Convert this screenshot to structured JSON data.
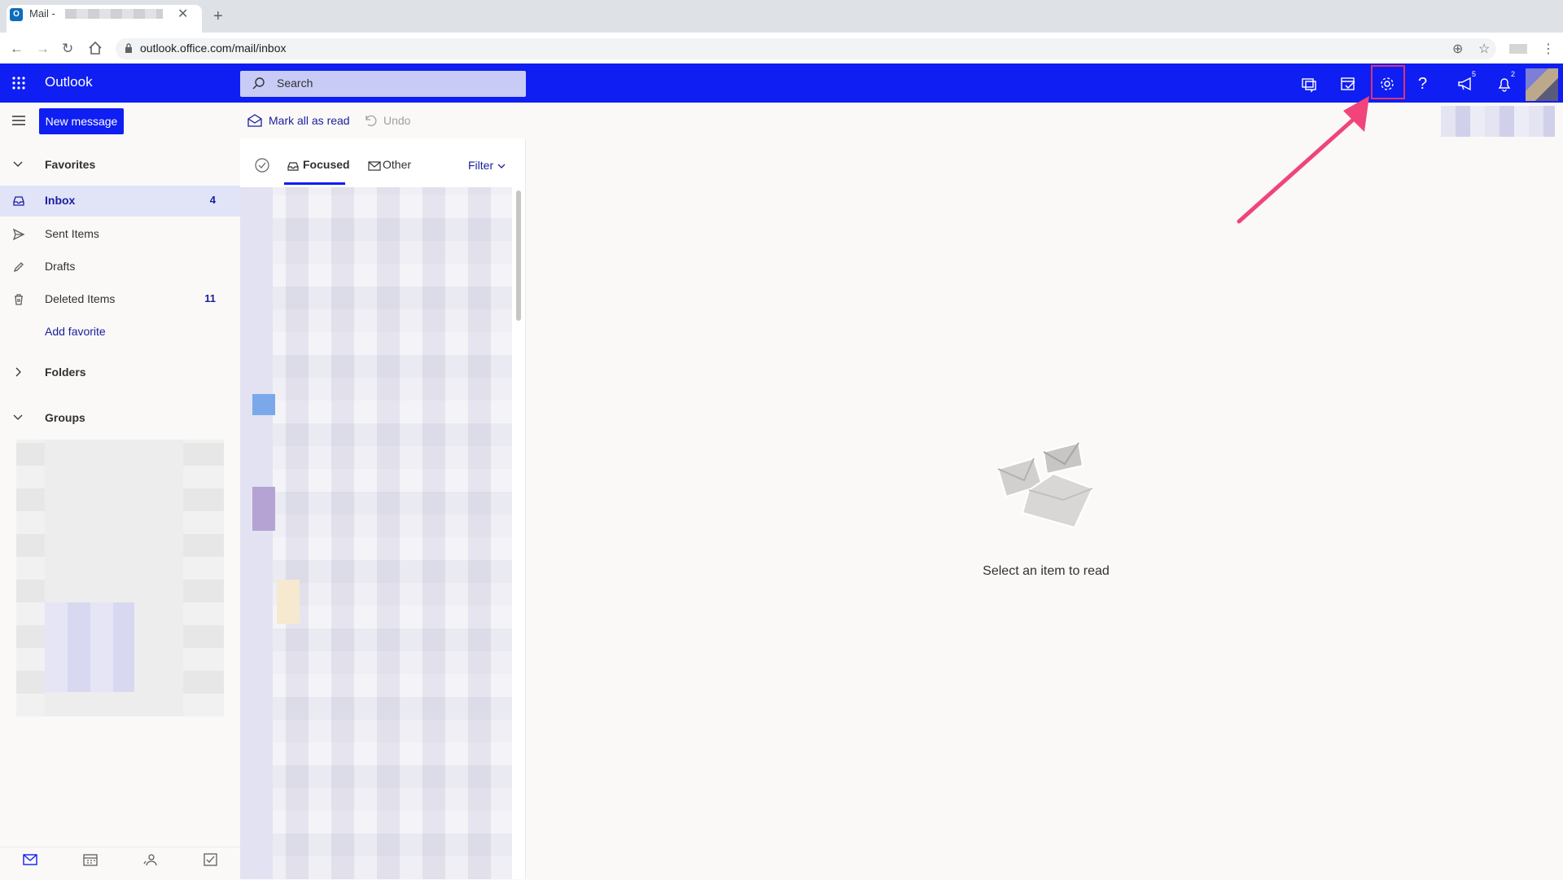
{
  "browser": {
    "tab_title": "Mail - ",
    "url": "outlook.office.com/mail/inbox"
  },
  "header": {
    "app_name": "Outlook",
    "search_placeholder": "Search",
    "badges": {
      "whats_new": "5",
      "notifications": "2"
    },
    "accent_color": "#0f1ef2",
    "highlight_color": "#e0336e"
  },
  "command_bar": {
    "new_message": "New message",
    "mark_all_read": "Mark all as read",
    "undo": "Undo"
  },
  "sidebar": {
    "favorites": "Favorites",
    "items": [
      {
        "label": "Inbox",
        "count": "4"
      },
      {
        "label": "Sent Items",
        "count": ""
      },
      {
        "label": "Drafts",
        "count": ""
      },
      {
        "label": "Deleted Items",
        "count": "11"
      }
    ],
    "add_favorite": "Add favorite",
    "folders": "Folders",
    "groups": "Groups"
  },
  "message_list": {
    "tabs": [
      "Focused",
      "Other"
    ],
    "filter": "Filter"
  },
  "reading_pane": {
    "empty_text": "Select an item to read"
  }
}
